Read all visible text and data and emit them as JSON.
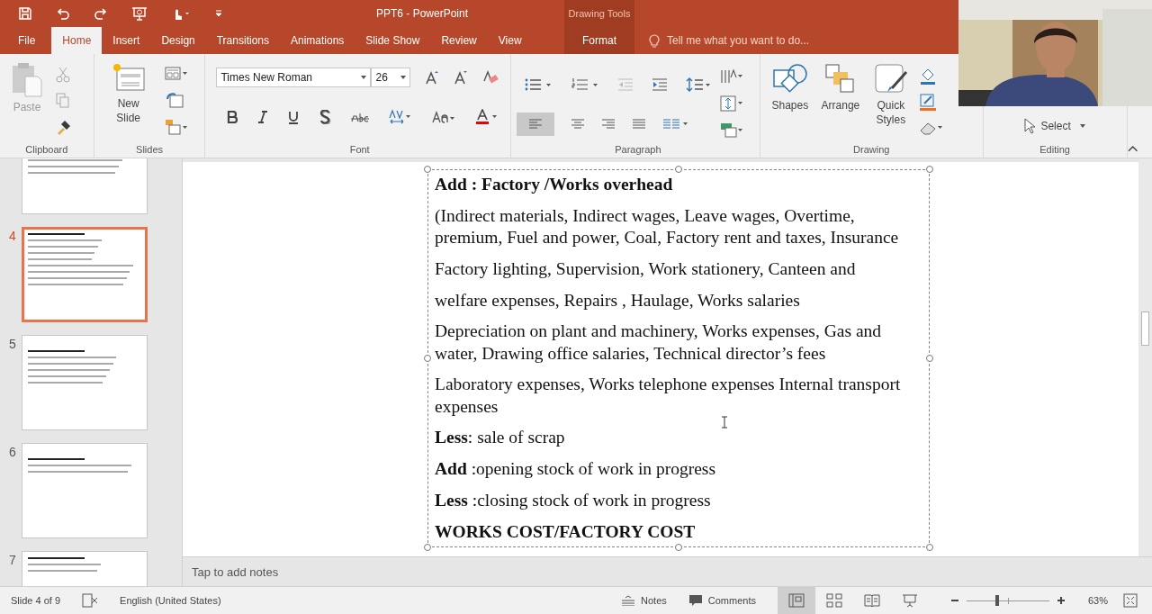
{
  "window": {
    "title": "PPT6 - PowerPoint",
    "context_label": "Drawing Tools"
  },
  "tabs": [
    {
      "label": "File",
      "kind": "file",
      "selected": false
    },
    {
      "label": "Home",
      "kind": "normal",
      "selected": true
    },
    {
      "label": "Insert",
      "kind": "normal",
      "selected": false
    },
    {
      "label": "Design",
      "kind": "normal",
      "selected": false
    },
    {
      "label": "Transitions",
      "kind": "normal",
      "selected": false
    },
    {
      "label": "Animations",
      "kind": "normal",
      "selected": false
    },
    {
      "label": "Slide Show",
      "kind": "normal",
      "selected": false
    },
    {
      "label": "Review",
      "kind": "normal",
      "selected": false
    },
    {
      "label": "View",
      "kind": "normal",
      "selected": false
    },
    {
      "label": "Format",
      "kind": "contextual",
      "selected": false
    }
  ],
  "tell_me": {
    "placeholder": "Tell me what you want to do..."
  },
  "ribbon": {
    "clipboard": {
      "label": "Clipboard",
      "paste": "Paste"
    },
    "slides": {
      "label": "Slides",
      "new_slide": "New Slide"
    },
    "font": {
      "label": "Font",
      "font_name": "Times New Roman",
      "font_size": "26"
    },
    "paragraph": {
      "label": "Paragraph"
    },
    "drawing": {
      "label": "Drawing",
      "buttons": [
        "Shapes",
        "Arrange",
        "Quick Styles"
      ]
    },
    "editing": {
      "label": "Editing",
      "select": "Select"
    }
  },
  "thumbnails": [
    {
      "selected": false
    },
    {
      "number": "4",
      "selected": true
    },
    {
      "number": "5",
      "selected": false
    },
    {
      "number": "6",
      "selected": false
    },
    {
      "number": "7",
      "selected": false
    }
  ],
  "slide": {
    "paragraphs": [
      {
        "kind": "heading",
        "text": "Add : Factory /Works overhead"
      },
      {
        "kind": "body",
        "text": "(Indirect materials, Indirect wages, Leave wages, Overtime, premium, Fuel and power, Coal, Factory rent and taxes, Insurance"
      },
      {
        "kind": "body",
        "text": "Factory lighting, Supervision, Work stationery, Canteen and"
      },
      {
        "kind": "body",
        "text": "welfare expenses, Repairs , Haulage, Works salaries"
      },
      {
        "kind": "body",
        "text": "Depreciation on plant and machinery, Works expenses, Gas and water, Drawing office salaries, Technical director’s fees"
      },
      {
        "kind": "body",
        "text": "Laboratory expenses, Works telephone expenses Internal transport expenses"
      },
      {
        "kind": "body",
        "text": "**Less**: sale of scrap"
      },
      {
        "kind": "body",
        "text": "**Add**  :opening stock of work in progress"
      },
      {
        "kind": "body",
        "text": "**Less** :closing stock of work in progress"
      },
      {
        "kind": "heading",
        "text": "WORKS COST/FACTORY COST"
      }
    ]
  },
  "notes": {
    "placeholder": "Tap to add notes"
  },
  "status_bar": {
    "slide_info": "Slide 4 of 9",
    "language": "English (United States)",
    "notes": "Notes",
    "comments": "Comments",
    "views": [
      {
        "kind": "normal",
        "selected": true
      },
      {
        "kind": "sorter",
        "selected": false
      },
      {
        "kind": "reading",
        "selected": false
      },
      {
        "kind": "show",
        "selected": false
      }
    ],
    "zoom": {
      "level": 0.37,
      "reading": "63%"
    }
  }
}
